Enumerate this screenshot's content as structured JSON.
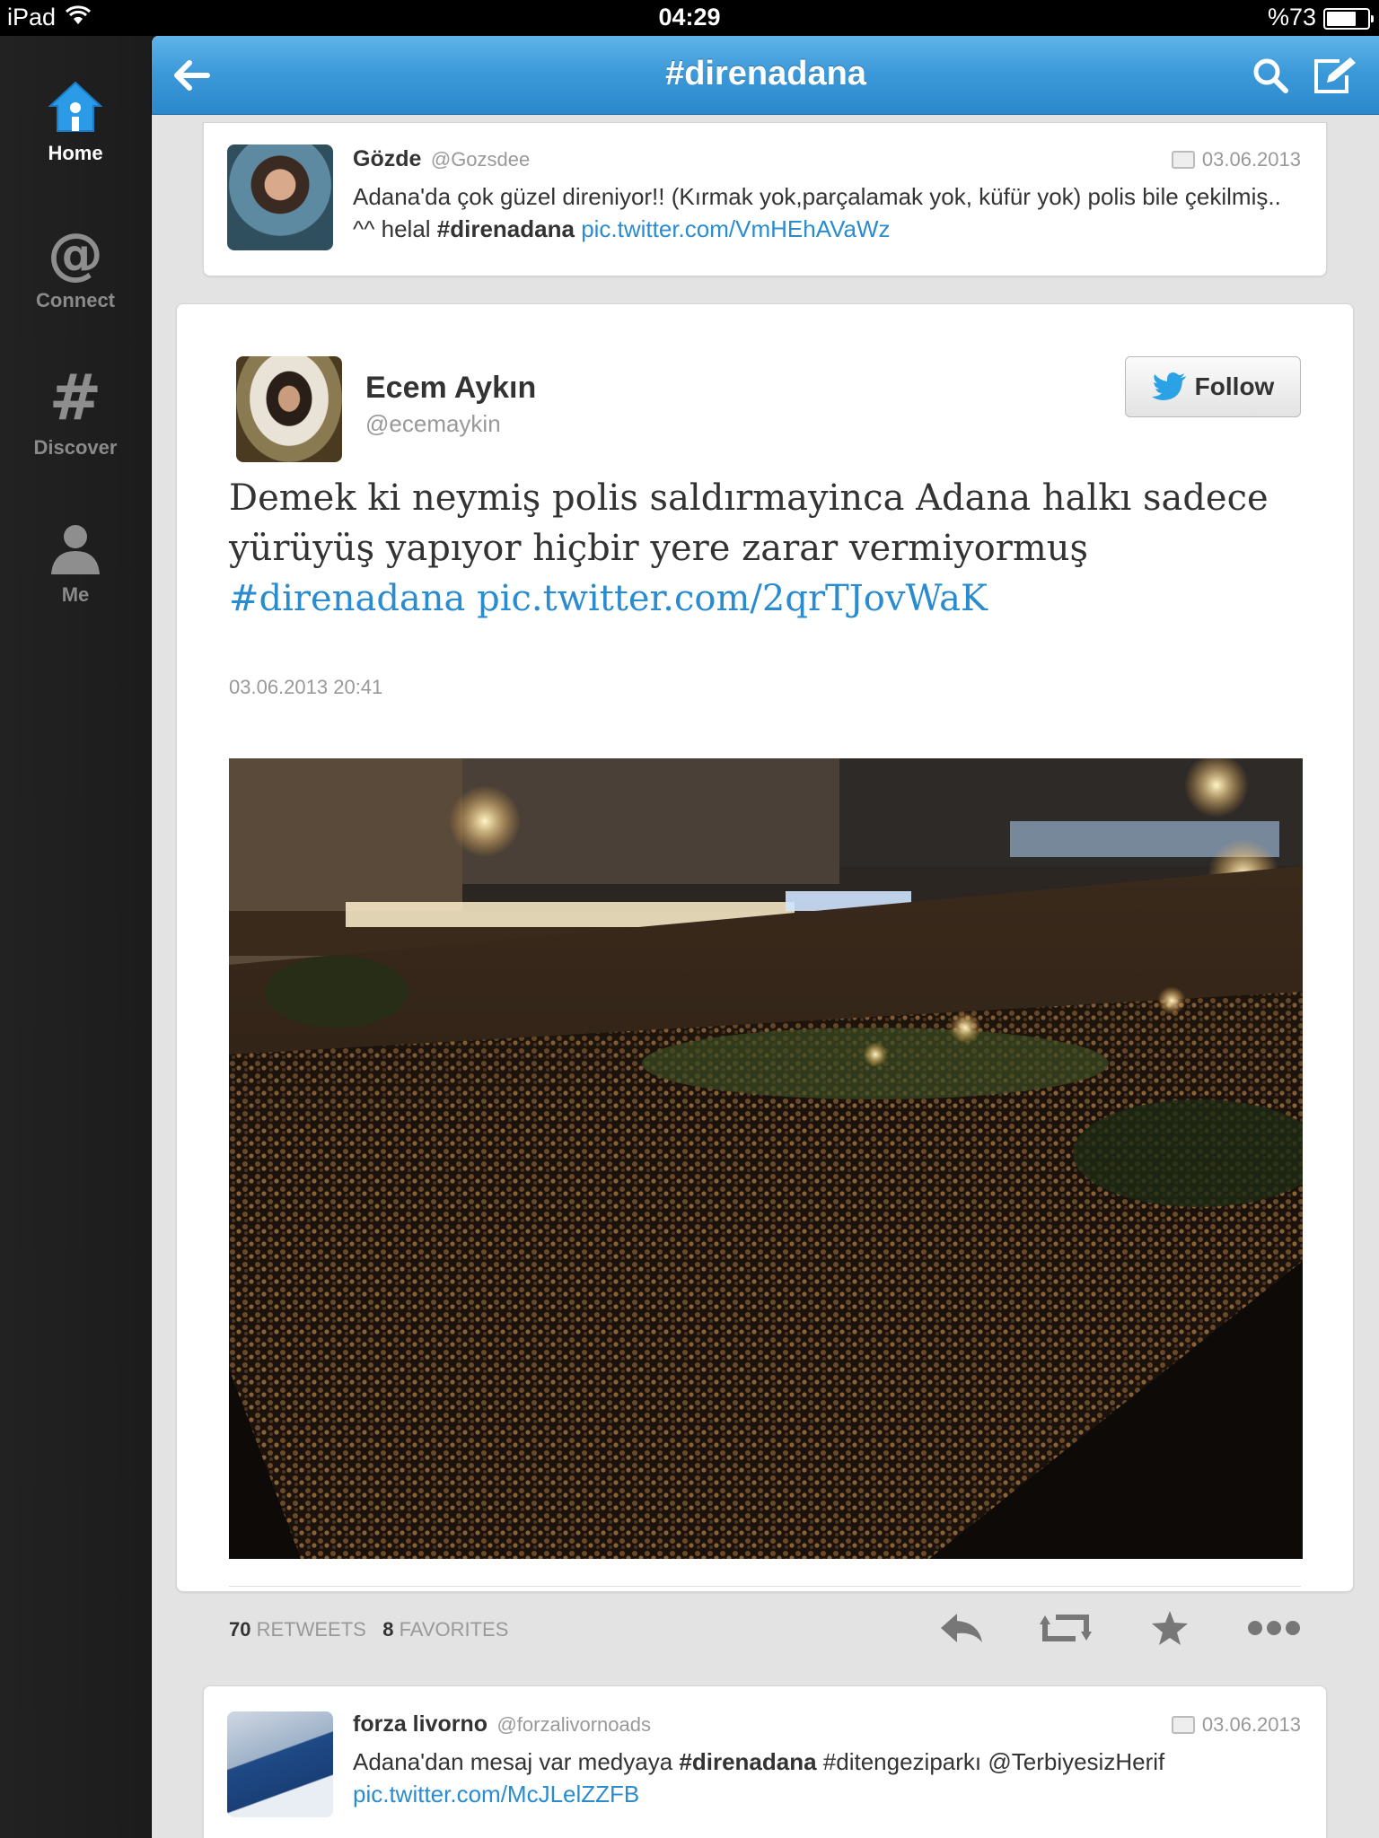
{
  "status_bar": {
    "device": "iPad",
    "time": "04:29",
    "battery": "%73",
    "battery_level": 0.73
  },
  "sidebar": {
    "items": [
      {
        "label": "Home",
        "icon": "home-icon",
        "active": true
      },
      {
        "label": "Connect",
        "icon": "at-icon",
        "active": false
      },
      {
        "label": "Discover",
        "icon": "hash-icon",
        "active": false
      },
      {
        "label": "Me",
        "icon": "person-icon",
        "active": false
      }
    ]
  },
  "header": {
    "title": "#direnadana",
    "back_icon": "back-arrow-icon",
    "search_icon": "search-icon",
    "compose_icon": "compose-icon"
  },
  "tweets": {
    "top": {
      "name": "Gözde",
      "handle": "@Gozsdee",
      "date": "03.06.2013",
      "text_a": "Adana'da çok güzel direniyor!! (Kırmak yok,parçalamak yok, küfür yok) polis bile çekilmiş.. ^^ helal ",
      "hashtag": "#direnadana",
      "link": "pic.twitter.com/VmHEhAVaWz"
    },
    "main": {
      "name": "Ecem Aykın",
      "handle": "@ecemaykin",
      "follow_label": "Follow",
      "text": "Demek ki neymiş polis saldırmayinca Adana halkı sadece yürüyüş yapıyor hiçbir yere zarar vermiyormuş ",
      "hashtag": "#direnadana",
      "link": "pic.twitter.com/2qrTJovWaK",
      "datetime": "03.06.2013 20:41",
      "retweets_count": "70",
      "retweets_label": "RETWEETS",
      "favorites_count": "8",
      "favorites_label": "FAVORITES",
      "actions": [
        "reply-icon",
        "retweet-icon",
        "favorite-star-icon",
        "more-icon"
      ]
    },
    "bottom": {
      "name": "forza livorno",
      "handle": "@forzalivornoads",
      "date": "03.06.2013",
      "text_a": "Adana'dan mesaj var medyaya ",
      "hashtag": "#direnadana",
      "text_b": " #ditengeziparkı @TerbiyesizHerif",
      "link": "pic.twitter.com/McJLelZZFB"
    }
  },
  "colors": {
    "accent": "#2a8ccf",
    "header_blue": "#3d9ad9",
    "sidebar_bg": "#1f1f1f"
  }
}
